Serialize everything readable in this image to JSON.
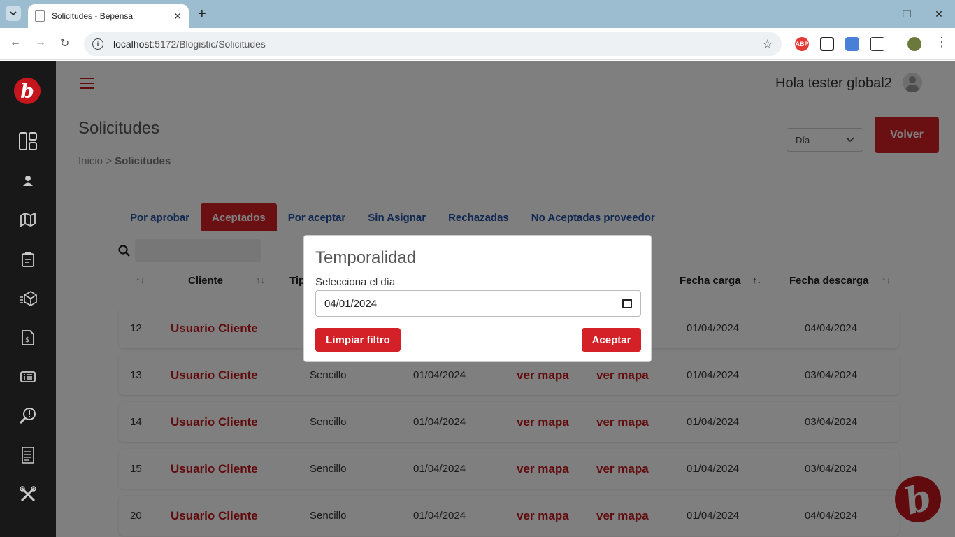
{
  "browser": {
    "tab_title": "Solicitudes - Bepensa",
    "url_host": "localhost",
    "url_path": ":5172/Blogistic/Solicitudes",
    "ext_abp": "ABP"
  },
  "header": {
    "greeting": "Hola tester global2"
  },
  "page": {
    "title": "Solicitudes",
    "breadcrumb_home": "Inicio",
    "breadcrumb_sep": ">",
    "breadcrumb_current": "Solicitudes",
    "select_value": "Día",
    "volver_label": "Volver"
  },
  "tabs": [
    "Por aprobar",
    "Aceptados",
    "Por aceptar",
    "Sin Asignar",
    "Rechazadas",
    "No Aceptadas proveedor"
  ],
  "table": {
    "columns": {
      "cliente": "Cliente",
      "tipo": "Tipo",
      "fecha_carga": "Fecha carga",
      "fecha_descarga": "Fecha descarga"
    },
    "rows": [
      {
        "id": "12",
        "cliente": "Usuario Cliente",
        "tipo": "",
        "fecha": "",
        "origen": "",
        "destino": "",
        "carga": "01/04/2024",
        "descarga": "04/04/2024"
      },
      {
        "id": "13",
        "cliente": "Usuario Cliente",
        "tipo": "Sencillo",
        "fecha": "01/04/2024",
        "origen": "ver mapa",
        "destino": "ver mapa",
        "carga": "01/04/2024",
        "descarga": "03/04/2024"
      },
      {
        "id": "14",
        "cliente": "Usuario Cliente",
        "tipo": "Sencillo",
        "fecha": "01/04/2024",
        "origen": "ver mapa",
        "destino": "ver mapa",
        "carga": "01/04/2024",
        "descarga": "03/04/2024"
      },
      {
        "id": "15",
        "cliente": "Usuario Cliente",
        "tipo": "Sencillo",
        "fecha": "01/04/2024",
        "origen": "ver mapa",
        "destino": "ver mapa",
        "carga": "01/04/2024",
        "descarga": "03/04/2024"
      },
      {
        "id": "20",
        "cliente": "Usuario Cliente",
        "tipo": "Sencillo",
        "fecha": "01/04/2024",
        "origen": "ver mapa",
        "destino": "ver mapa",
        "carga": "01/04/2024",
        "descarga": "04/04/2024"
      }
    ]
  },
  "modal": {
    "title": "Temporalidad",
    "label": "Selecciona el día",
    "date_value": "04/01/2024",
    "clear_label": "Limpiar filtro",
    "accept_label": "Aceptar"
  },
  "colors": {
    "brand_red": "#d42027",
    "sidebar": "#181818",
    "tab_blue": "#1f4fa3"
  }
}
